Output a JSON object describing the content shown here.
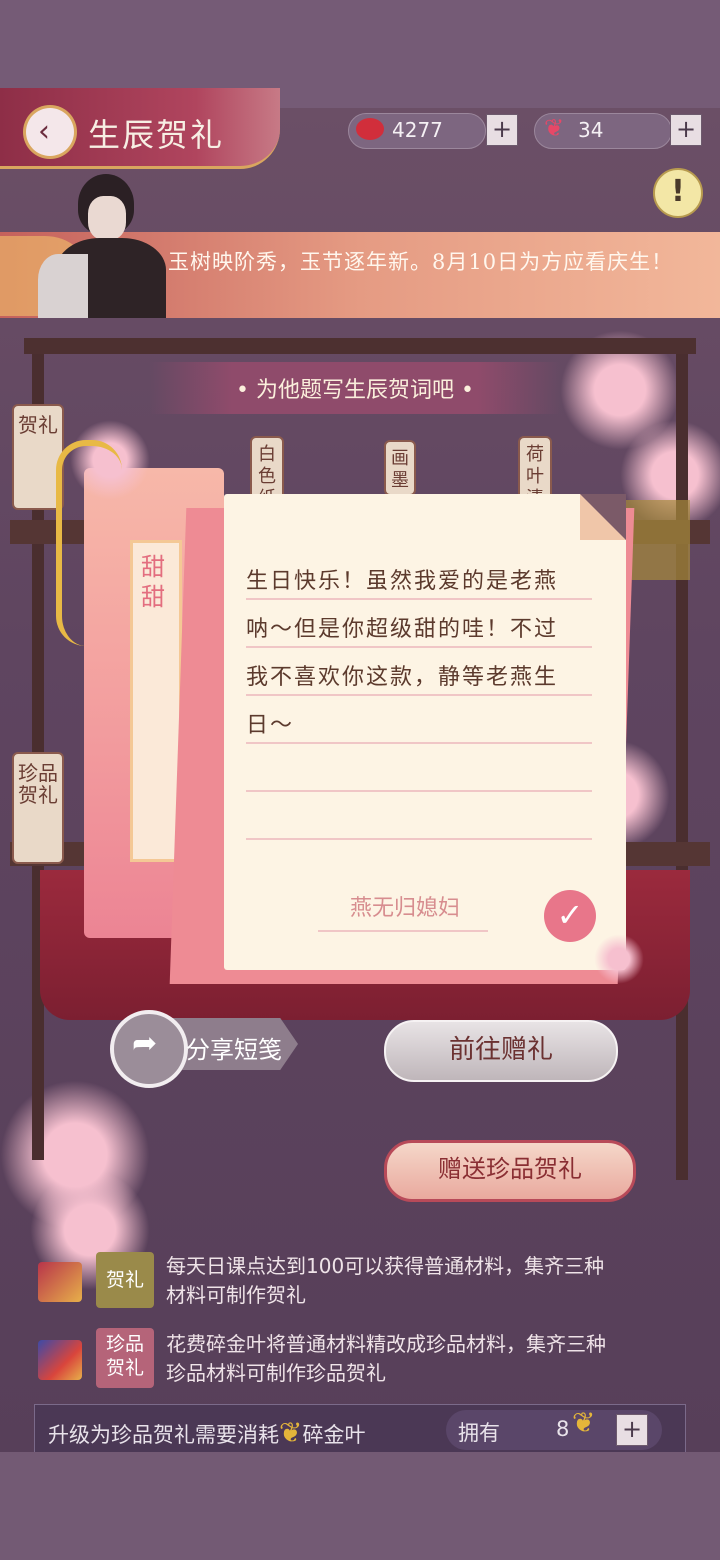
{
  "header": {
    "title": "生辰贺礼",
    "currency_red": "4277",
    "currency_butterfly": "34",
    "plus": "+",
    "alert_symbol": "!"
  },
  "banner": {
    "text": "玉树映阶秀，玉节逐年新。8月10日为方应看庆生！"
  },
  "heading": "• 为他题写生辰贺词吧 •",
  "side_tags": {
    "tag1": "贺礼",
    "tag2": "珍品贺礼"
  },
  "shelf_labels": [
    "白色纸",
    "画墨",
    "荷叶清"
  ],
  "letter": {
    "recipient": "甜甜",
    "lines": [
      "生日快乐！虽然我爱的是老燕",
      "呐～但是你超级甜的哇！不过",
      "我不喜欢你这款，静等老燕生",
      "日～"
    ],
    "signature": "燕无归媳妇",
    "confirm_symbol": "✓"
  },
  "buttons": {
    "share": "分享短笺",
    "goto_gift": "前往赠礼",
    "send_premium": "赠送珍品贺礼"
  },
  "info": {
    "row1_badge": "贺礼",
    "row1_text_l1": "每天日课点达到100可以获得普通材料，集齐三种",
    "row1_text_l2": "材料可制作贺礼",
    "row2_badge": "珍品贺礼",
    "row2_text_l1": "花费碎金叶将普通材料精改成珍品材料，集齐三种",
    "row2_text_l2": "珍品材料可制作珍品贺礼"
  },
  "bottom_bar": {
    "text_prefix": "升级为珍品贺礼需要消耗",
    "text_suffix": "碎金叶",
    "own_label": "拥有",
    "own_value": "8",
    "plus": "+"
  },
  "colors": {
    "accent_pink": "#e8768a",
    "card_red": "#b84a59",
    "gold": "#e4b53a"
  }
}
